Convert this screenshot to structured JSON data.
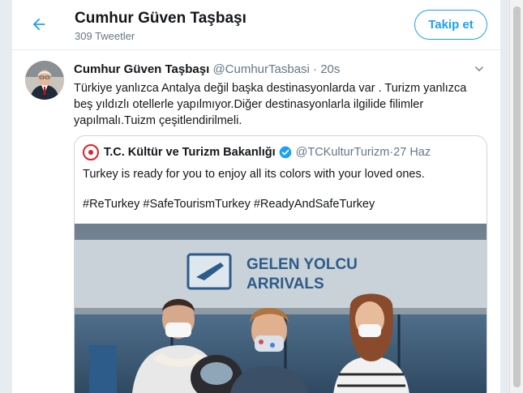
{
  "header": {
    "name": "Cumhur Güven Taşbaşı",
    "tweet_count": "309 Tweetler",
    "follow_label": "Takip et"
  },
  "tweet": {
    "author_name": "Cumhur Güven Taşbaşı",
    "author_handle": "@CumhurTasbasi",
    "separator": "·",
    "time": "20s",
    "text": "Türkiye yanlızca Antalya değil başka destinasyonlarda var . Turizm yanlızca beş yıldızlı otellerle yapılmıyor.Diğer destinasyonlarla ilgilide filimler yapılmalı.Tuizm çeşitlendirilmeli."
  },
  "quote": {
    "author_name": "T.C. Kültür ve Turizm Bakanlığı",
    "author_handle": "@TCKulturTurizm",
    "separator": "·",
    "date": "27 Haz",
    "text": "Turkey is ready for you to enjoy all its colors with your loved ones.",
    "hashtags": "#ReTurkey #SafeTourismTurkey #ReadyAndSafeTurkey",
    "media_sign_line1": "GELEN YOLCU",
    "media_sign_line2": "ARRIVALS"
  },
  "icons": {
    "back": "arrow-left-icon",
    "caret": "chevron-down-icon",
    "verified": "verified-badge-icon",
    "quote_logo": "ministry-logo-icon"
  },
  "colors": {
    "accent": "#1da1f2",
    "text_primary": "#14171a",
    "text_secondary": "#657786",
    "border": "#e6ecf0"
  }
}
